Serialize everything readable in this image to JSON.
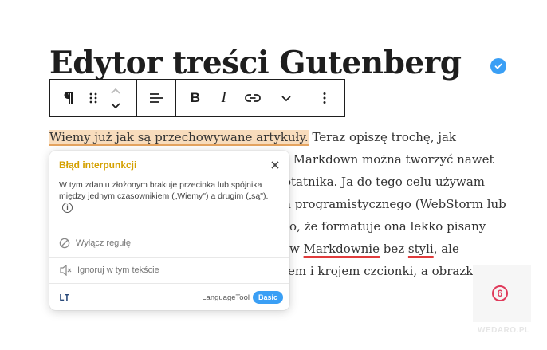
{
  "document": {
    "title": "Edytor treści Gutenberg",
    "paragraph": {
      "highlight": "Wiemy już jak są przechowywane artykuły.",
      "line1_rest": " Teraz opiszę trochę, jak",
      "line2": "i Markdown można tworzyć nawet",
      "line3": "otatnika. Ja do tego celu używam",
      "line4": "a programistycznego (WebStorm lub",
      "line5": "to, że formatuje ona lekko pisany",
      "line6_pre": "w ",
      "line6_word1": "Markdownie",
      "line6_mid": " bez ",
      "line6_word2": "styli",
      "line6_post": ", ale",
      "line7": "em i krojem czcionki, a obrazki mają"
    }
  },
  "toolbar": {
    "buttons": [
      "paragraph-icon",
      "drag-handle-icon",
      "move-up-icon",
      "move-down-icon",
      "align-left-icon",
      "bold-icon",
      "italic-icon",
      "link-icon",
      "more-rich-text-icon",
      "options-icon"
    ],
    "bold_label": "B",
    "italic_label": "I"
  },
  "popup": {
    "title": "Błąd interpunkcji",
    "description": "W tym zdaniu złożonym brakuje przecinka lub spójnika między jednym czasownikiem („Wiemy\") a drugim („są\").",
    "disable_rule": "Wyłącz regułę",
    "ignore_in_text": "Ignoruj w tym tekście",
    "brand_logo": "LT",
    "brand_name": "LanguageTool",
    "plan_badge": "Basic",
    "accent_color": "#3a9ff5",
    "title_color": "#d4a000"
  },
  "watermark": {
    "number": "6",
    "text": "WEDARO.PL"
  }
}
